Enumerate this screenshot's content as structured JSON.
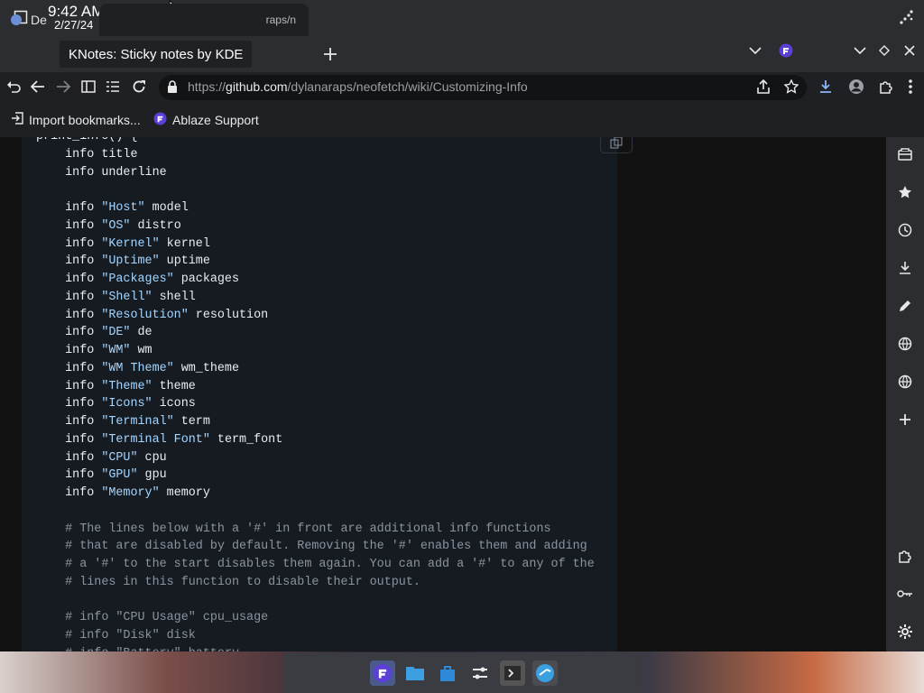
{
  "system": {
    "time": "9:42 AM",
    "date": "2/27/24"
  },
  "tabs": {
    "tab1_label": "De",
    "tab2_label": "raps/n",
    "tooltip": "KNotes: Sticky notes by KDE"
  },
  "address": {
    "url_prefix": "https://",
    "url_host": "github.com",
    "url_path": "/dylanaraps/neofetch/wiki/Customizing-Info"
  },
  "bookmarks": [
    {
      "label": "Import bookmarks..."
    },
    {
      "label": "Ablaze Support"
    }
  ],
  "code": {
    "lines": [
      [
        {
          "t": "print_info() {",
          "c": ""
        }
      ],
      [
        {
          "t": "    info title",
          "c": ""
        }
      ],
      [
        {
          "t": "    info underline",
          "c": ""
        }
      ],
      [
        {
          "t": "",
          "c": ""
        }
      ],
      [
        {
          "t": "    info ",
          "c": ""
        },
        {
          "t": "\"Host\"",
          "c": "str"
        },
        {
          "t": " model",
          "c": ""
        }
      ],
      [
        {
          "t": "    info ",
          "c": ""
        },
        {
          "t": "\"OS\"",
          "c": "str"
        },
        {
          "t": " distro",
          "c": ""
        }
      ],
      [
        {
          "t": "    info ",
          "c": ""
        },
        {
          "t": "\"Kernel\"",
          "c": "str"
        },
        {
          "t": " kernel",
          "c": ""
        }
      ],
      [
        {
          "t": "    info ",
          "c": ""
        },
        {
          "t": "\"Uptime\"",
          "c": "str"
        },
        {
          "t": " uptime",
          "c": ""
        }
      ],
      [
        {
          "t": "    info ",
          "c": ""
        },
        {
          "t": "\"Packages\"",
          "c": "str"
        },
        {
          "t": " packages",
          "c": ""
        }
      ],
      [
        {
          "t": "    info ",
          "c": ""
        },
        {
          "t": "\"Shell\"",
          "c": "str"
        },
        {
          "t": " shell",
          "c": ""
        }
      ],
      [
        {
          "t": "    info ",
          "c": ""
        },
        {
          "t": "\"Resolution\"",
          "c": "str"
        },
        {
          "t": " resolution",
          "c": ""
        }
      ],
      [
        {
          "t": "    info ",
          "c": ""
        },
        {
          "t": "\"DE\"",
          "c": "str"
        },
        {
          "t": " de",
          "c": ""
        }
      ],
      [
        {
          "t": "    info ",
          "c": ""
        },
        {
          "t": "\"WM\"",
          "c": "str"
        },
        {
          "t": " wm",
          "c": ""
        }
      ],
      [
        {
          "t": "    info ",
          "c": ""
        },
        {
          "t": "\"WM Theme\"",
          "c": "str"
        },
        {
          "t": " wm_theme",
          "c": ""
        }
      ],
      [
        {
          "t": "    info ",
          "c": ""
        },
        {
          "t": "\"Theme\"",
          "c": "str"
        },
        {
          "t": " theme",
          "c": ""
        }
      ],
      [
        {
          "t": "    info ",
          "c": ""
        },
        {
          "t": "\"Icons\"",
          "c": "str"
        },
        {
          "t": " icons",
          "c": ""
        }
      ],
      [
        {
          "t": "    info ",
          "c": ""
        },
        {
          "t": "\"Terminal\"",
          "c": "str"
        },
        {
          "t": " term",
          "c": ""
        }
      ],
      [
        {
          "t": "    info ",
          "c": ""
        },
        {
          "t": "\"Terminal Font\"",
          "c": "str"
        },
        {
          "t": " term_font",
          "c": ""
        }
      ],
      [
        {
          "t": "    info ",
          "c": ""
        },
        {
          "t": "\"CPU\"",
          "c": "str"
        },
        {
          "t": " cpu",
          "c": ""
        }
      ],
      [
        {
          "t": "    info ",
          "c": ""
        },
        {
          "t": "\"GPU\"",
          "c": "str"
        },
        {
          "t": " gpu",
          "c": ""
        }
      ],
      [
        {
          "t": "    info ",
          "c": ""
        },
        {
          "t": "\"Memory\"",
          "c": "str"
        },
        {
          "t": " memory",
          "c": ""
        }
      ],
      [
        {
          "t": "",
          "c": ""
        }
      ],
      [
        {
          "t": "    # The lines below with a '#' in front are additional info functions",
          "c": "com"
        }
      ],
      [
        {
          "t": "    # that are disabled by default. Removing the '#' enables them and adding",
          "c": "com"
        }
      ],
      [
        {
          "t": "    # a '#' to the start disables them again. You can add a '#' to any of the",
          "c": "com"
        }
      ],
      [
        {
          "t": "    # lines in this function to disable their output.",
          "c": "com"
        }
      ],
      [
        {
          "t": "",
          "c": ""
        }
      ],
      [
        {
          "t": "    # info \"CPU Usage\" cpu_usage",
          "c": "com"
        }
      ],
      [
        {
          "t": "    # info \"Disk\" disk",
          "c": "com"
        }
      ],
      [
        {
          "t": "    # info \"Battery\" battery",
          "c": "com"
        }
      ]
    ]
  },
  "colors": {
    "string": "#a5d6ff",
    "comment": "#8b949e",
    "code_bg": "#161b22",
    "accent": "#8ab4f8"
  }
}
